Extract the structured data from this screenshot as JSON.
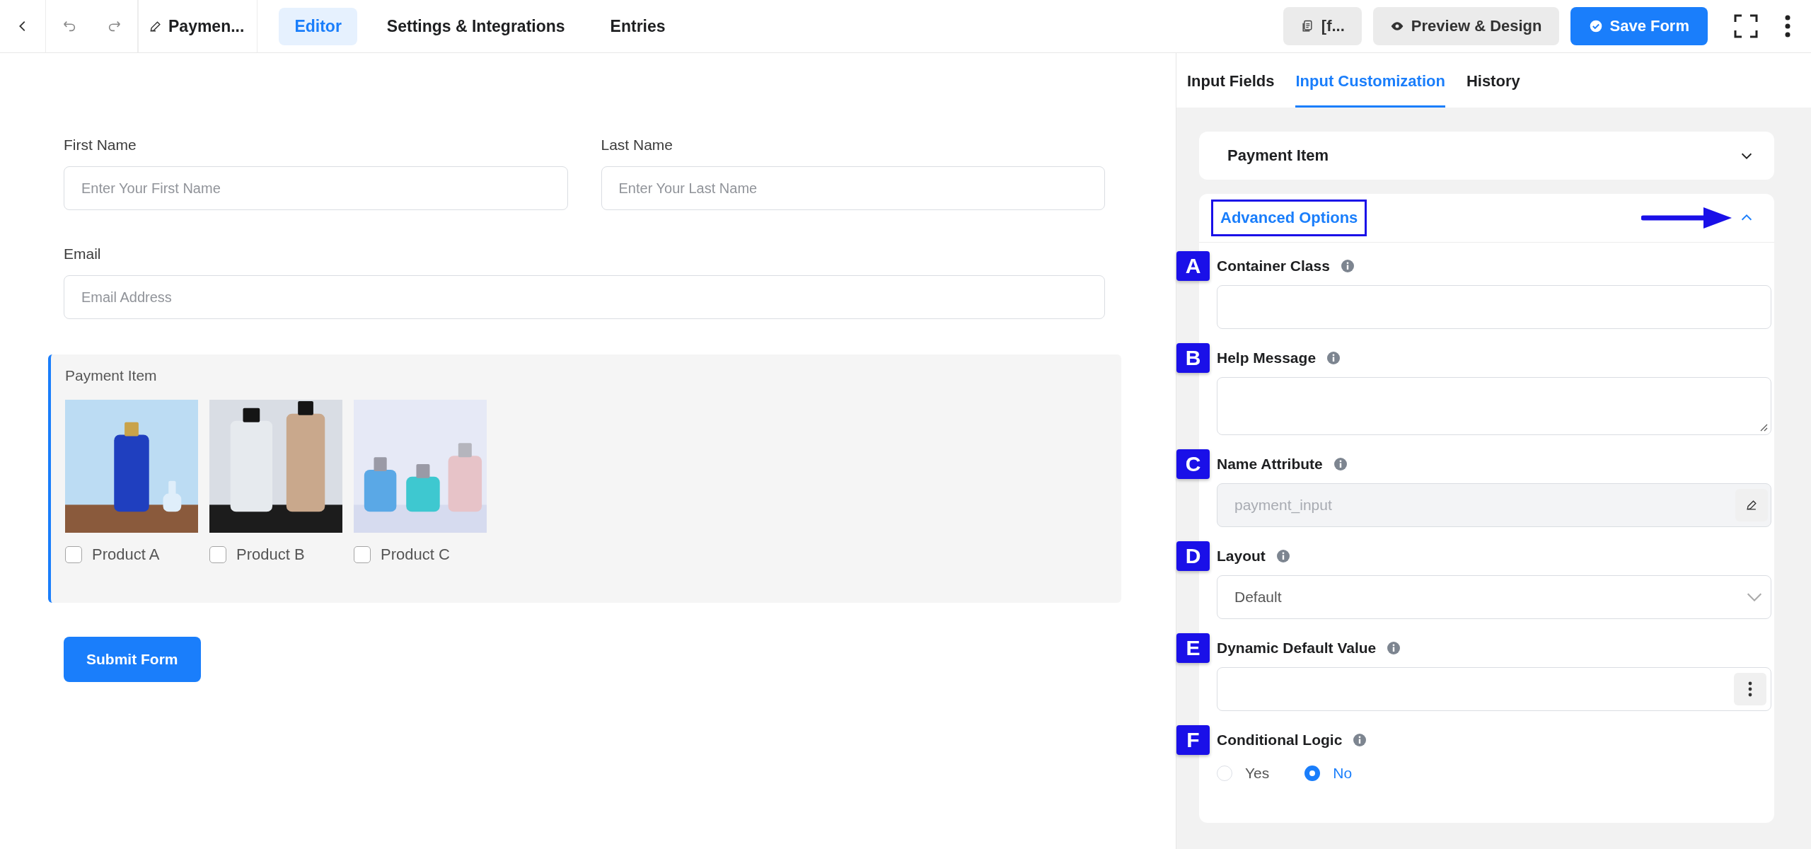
{
  "toolbar": {
    "form_name": "Paymen...",
    "tabs": [
      {
        "label": "Editor",
        "selected": true
      },
      {
        "label": "Settings & Integrations",
        "selected": false
      },
      {
        "label": "Entries",
        "selected": false
      }
    ],
    "shortcode": "[f...",
    "preview": "Preview & Design",
    "save": "Save Form"
  },
  "form": {
    "rows": [
      [
        {
          "label": "First Name",
          "placeholder": "Enter Your First Name"
        },
        {
          "label": "Last Name",
          "placeholder": "Enter Your Last Name"
        }
      ],
      [
        {
          "label": "Email",
          "placeholder": "Email Address"
        }
      ]
    ],
    "payment_item": {
      "label": "Payment Item",
      "products": [
        {
          "name": "Product A",
          "checked": false,
          "kind": "picture"
        },
        {
          "name": "Product B",
          "checked": false,
          "kind": "picture"
        },
        {
          "name": "Product C",
          "checked": false,
          "kind": "picture"
        }
      ]
    },
    "submit": "Submit Form"
  },
  "panel": {
    "tabs": [
      {
        "label": "Input Fields",
        "selected": false
      },
      {
        "label": "Input Customization",
        "selected": true
      },
      {
        "label": "History",
        "selected": false
      }
    ],
    "sections": [
      {
        "title": "Payment Item",
        "expanded": false,
        "highlighted": false,
        "arrow": false
      },
      {
        "title": "Advanced Options",
        "expanded": true,
        "highlighted": true,
        "arrow": true
      }
    ],
    "options": [
      {
        "badge": "A",
        "label": "Container Class",
        "kind": "text"
      },
      {
        "badge": "B",
        "label": "Help Message",
        "kind": "textarea"
      },
      {
        "badge": "C",
        "label": "Name Attribute",
        "kind": "locked",
        "value": "payment_input"
      },
      {
        "badge": "D",
        "label": "Layout",
        "kind": "select",
        "value": "Default"
      },
      {
        "badge": "E",
        "label": "Dynamic Default Value",
        "kind": "dynamic"
      },
      {
        "badge": "F",
        "label": "Conditional Logic",
        "kind": "radio",
        "choices": [
          {
            "label": "Yes",
            "selected": false
          },
          {
            "label": "No",
            "selected": true
          }
        ]
      }
    ]
  }
}
